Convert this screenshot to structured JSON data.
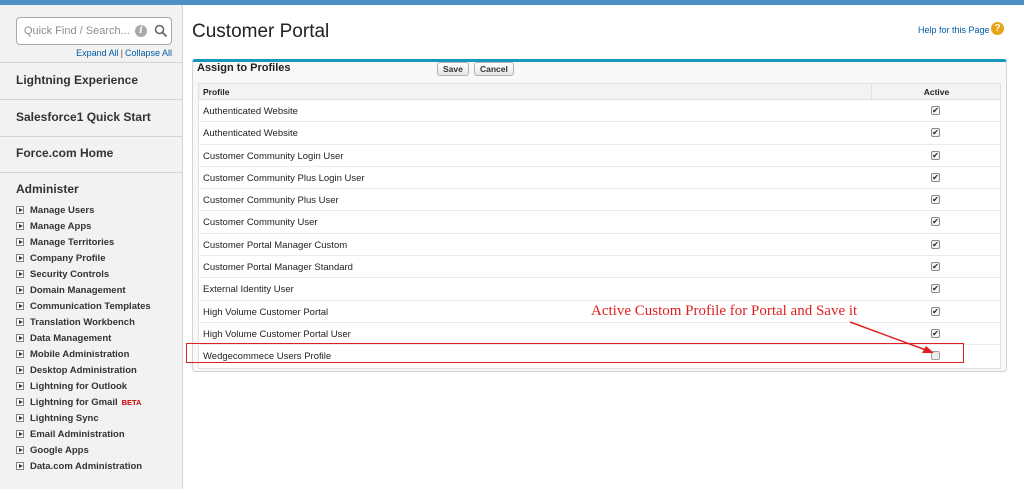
{
  "sidebar": {
    "search_placeholder": "Quick Find / Search...",
    "expand_all": "Expand All",
    "collapse_all": "Collapse All",
    "sections": [
      "Lightning Experience",
      "Salesforce1 Quick Start",
      "Force.com Home",
      "Administer"
    ],
    "items": [
      "Manage Users",
      "Manage Apps",
      "Manage Territories",
      "Company Profile",
      "Security Controls",
      "Domain Management",
      "Communication Templates",
      "Translation Workbench",
      "Data Management",
      "Mobile Administration",
      "Desktop Administration",
      "Lightning for Outlook",
      "Lightning for Gmail",
      "Lightning Sync",
      "Email Administration",
      "Google Apps",
      "Data.com Administration"
    ],
    "beta_label": "BETA"
  },
  "header": {
    "title": "Customer Portal",
    "help_link": "Help for this Page"
  },
  "panel": {
    "title": "Assign to Profiles",
    "save_label": "Save",
    "cancel_label": "Cancel",
    "col_profile": "Profile",
    "col_active": "Active",
    "rows": [
      {
        "name": "Authenticated Website",
        "active": true
      },
      {
        "name": "Authenticated Website",
        "active": true
      },
      {
        "name": "Customer Community Login User",
        "active": true
      },
      {
        "name": "Customer Community Plus Login User",
        "active": true
      },
      {
        "name": "Customer Community Plus User",
        "active": true
      },
      {
        "name": "Customer Community User",
        "active": true
      },
      {
        "name": "Customer Portal Manager Custom",
        "active": true
      },
      {
        "name": "Customer Portal Manager Standard",
        "active": true
      },
      {
        "name": "External Identity User",
        "active": true
      },
      {
        "name": "High Volume Customer Portal",
        "active": true
      },
      {
        "name": "High Volume Customer Portal User",
        "active": true
      },
      {
        "name": "Wedgecommece Users Profile",
        "active": false
      }
    ]
  },
  "annotation": {
    "text": "Active Custom Profile for Portal and Save it",
    "color": "#e02020"
  },
  "colors": {
    "accent": "#1797c0",
    "link": "#015ba7",
    "topbar": "#4e8fc6"
  }
}
